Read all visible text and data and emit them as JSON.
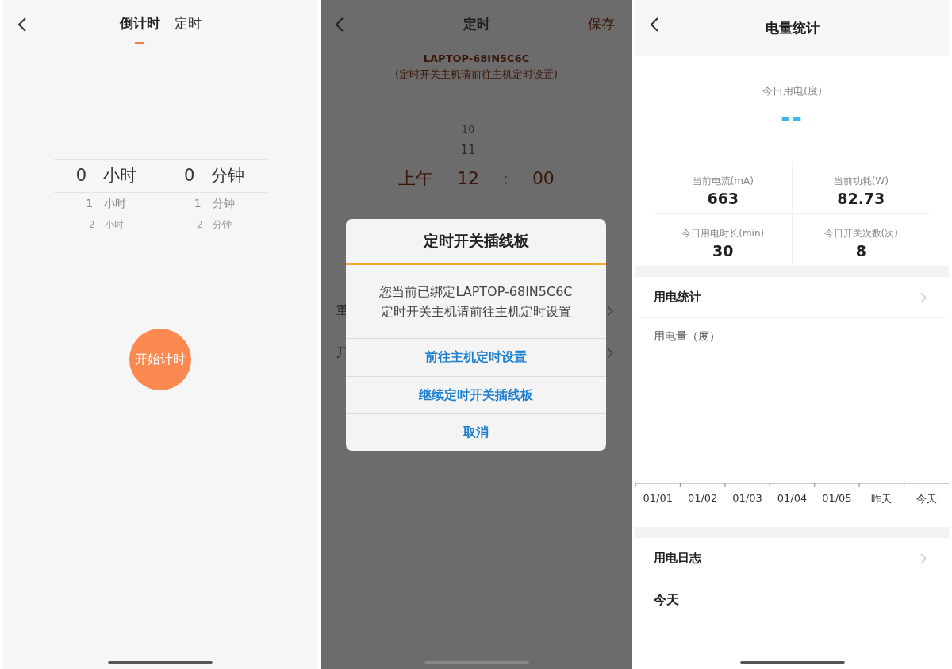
{
  "countdown": {
    "tabs": [
      {
        "label": "倒计时",
        "selected": true
      },
      {
        "label": "定时",
        "selected": false
      }
    ],
    "picker": [
      {
        "items": [
          {
            "value": "0",
            "unit": "小时",
            "selected": true
          },
          {
            "value": "1",
            "unit": "小时",
            "selected": false
          },
          {
            "value": "2",
            "unit": "小时",
            "selected": false
          }
        ]
      },
      {
        "items": [
          {
            "value": "0",
            "unit": "分钟",
            "selected": true
          },
          {
            "value": "1",
            "unit": "分钟",
            "selected": false
          },
          {
            "value": "2",
            "unit": "分钟",
            "selected": false
          }
        ]
      }
    ],
    "start_button": "开始计时"
  },
  "schedule": {
    "title": "定时",
    "save": "保存",
    "device": "LAPTOP-68IN5C6C",
    "note": "(定时开关主机请前往主机定时设置)",
    "picker": {
      "period": "上午",
      "hours": [
        {
          "value": "10",
          "selected": false
        },
        {
          "value": "11",
          "selected": false
        },
        {
          "value": "12",
          "selected": true
        }
      ],
      "separator": ":",
      "minute": "00"
    },
    "rows": [
      {
        "label": "重"
      },
      {
        "label": "开"
      }
    ],
    "dialog": {
      "title": "定时开关插线板",
      "message_lines": [
        "您当前已绑定LAPTOP-68IN5C6C",
        "定时开关主机请前往主机定时设置"
      ],
      "actions": [
        "前往主机定时设置",
        "继续定时开关插线板",
        "取消"
      ]
    }
  },
  "stats": {
    "title": "电量统计",
    "today_label": "今日用电(度)",
    "today_value": "--",
    "metrics": [
      {
        "label": "当前电流(mA)",
        "value": "663"
      },
      {
        "label": "当前功耗(W)",
        "value": "82.73"
      },
      {
        "label": "今日用电时长(min)",
        "value": "30"
      },
      {
        "label": "今日开关次数(次)",
        "value": "8"
      }
    ],
    "usage_row": "用电统计",
    "chart_label": "用电量（度）",
    "axis_labels": [
      "01/01",
      "01/02",
      "01/03",
      "01/04",
      "01/05",
      "昨天",
      "今天"
    ],
    "log_row": "用电日志",
    "log_day": "今天"
  }
}
